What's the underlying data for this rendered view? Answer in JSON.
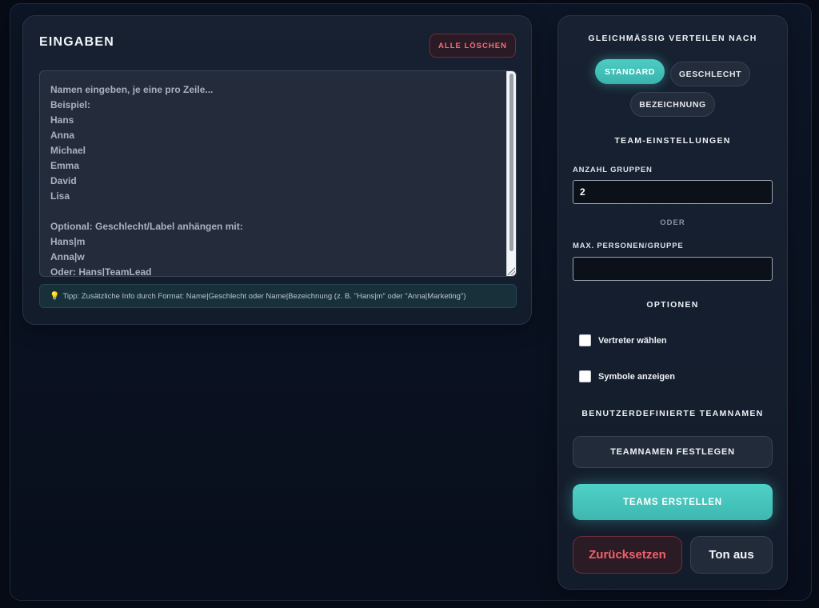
{
  "input_panel": {
    "title": "EINGABEN",
    "clear_label": "ALLE LÖSCHEN",
    "textarea_text": "Namen eingeben, je eine pro Zeile...\nBeispiel:\nHans\nAnna\nMichael\nEmma\nDavid\nLisa\n\nOptional: Geschlecht/Label anhängen mit:\nHans|m\nAnna|w\nOder: Hans|TeamLead",
    "tip_icon": "lightbulb-icon",
    "tip_bulb": "💡",
    "tip_text": "Tipp: Zusätzliche Info durch Format: Name|Geschlecht oder Name|Bezeichnung (z. B. \"Hans|m\" oder \"Anna|Marketing\")"
  },
  "settings_panel": {
    "distribute_heading": "GLEICHMÄSSIG VERTEILEN NACH",
    "distribute_options": {
      "standard": "STANDARD",
      "gender": "GESCHLECHT",
      "label": "BEZEICHNUNG"
    },
    "active_option": "standard",
    "team_heading": "TEAM-EINSTELLUNGEN",
    "groups_label": "ANZAHL GRUPPEN",
    "groups_value": "2",
    "or_label": "ODER",
    "max_label": "MAX. PERSONEN/GRUPPE",
    "max_value": "",
    "options_heading": "OPTIONEN",
    "option_representative": "Vertreter wählen",
    "option_symbols": "Symbole anzeigen",
    "custom_names_heading": "BENUTZERDEFINIERTE TEAMNAMEN",
    "set_names_label": "TEAMNAMEN FESTLEGEN",
    "create_label": "TEAMS ERSTELLEN",
    "reset_label": "Zurücksetzen",
    "sound_label": "Ton aus"
  },
  "colors": {
    "accent": "#4ccdc4",
    "danger": "#f2606c",
    "background": "#060b16"
  }
}
